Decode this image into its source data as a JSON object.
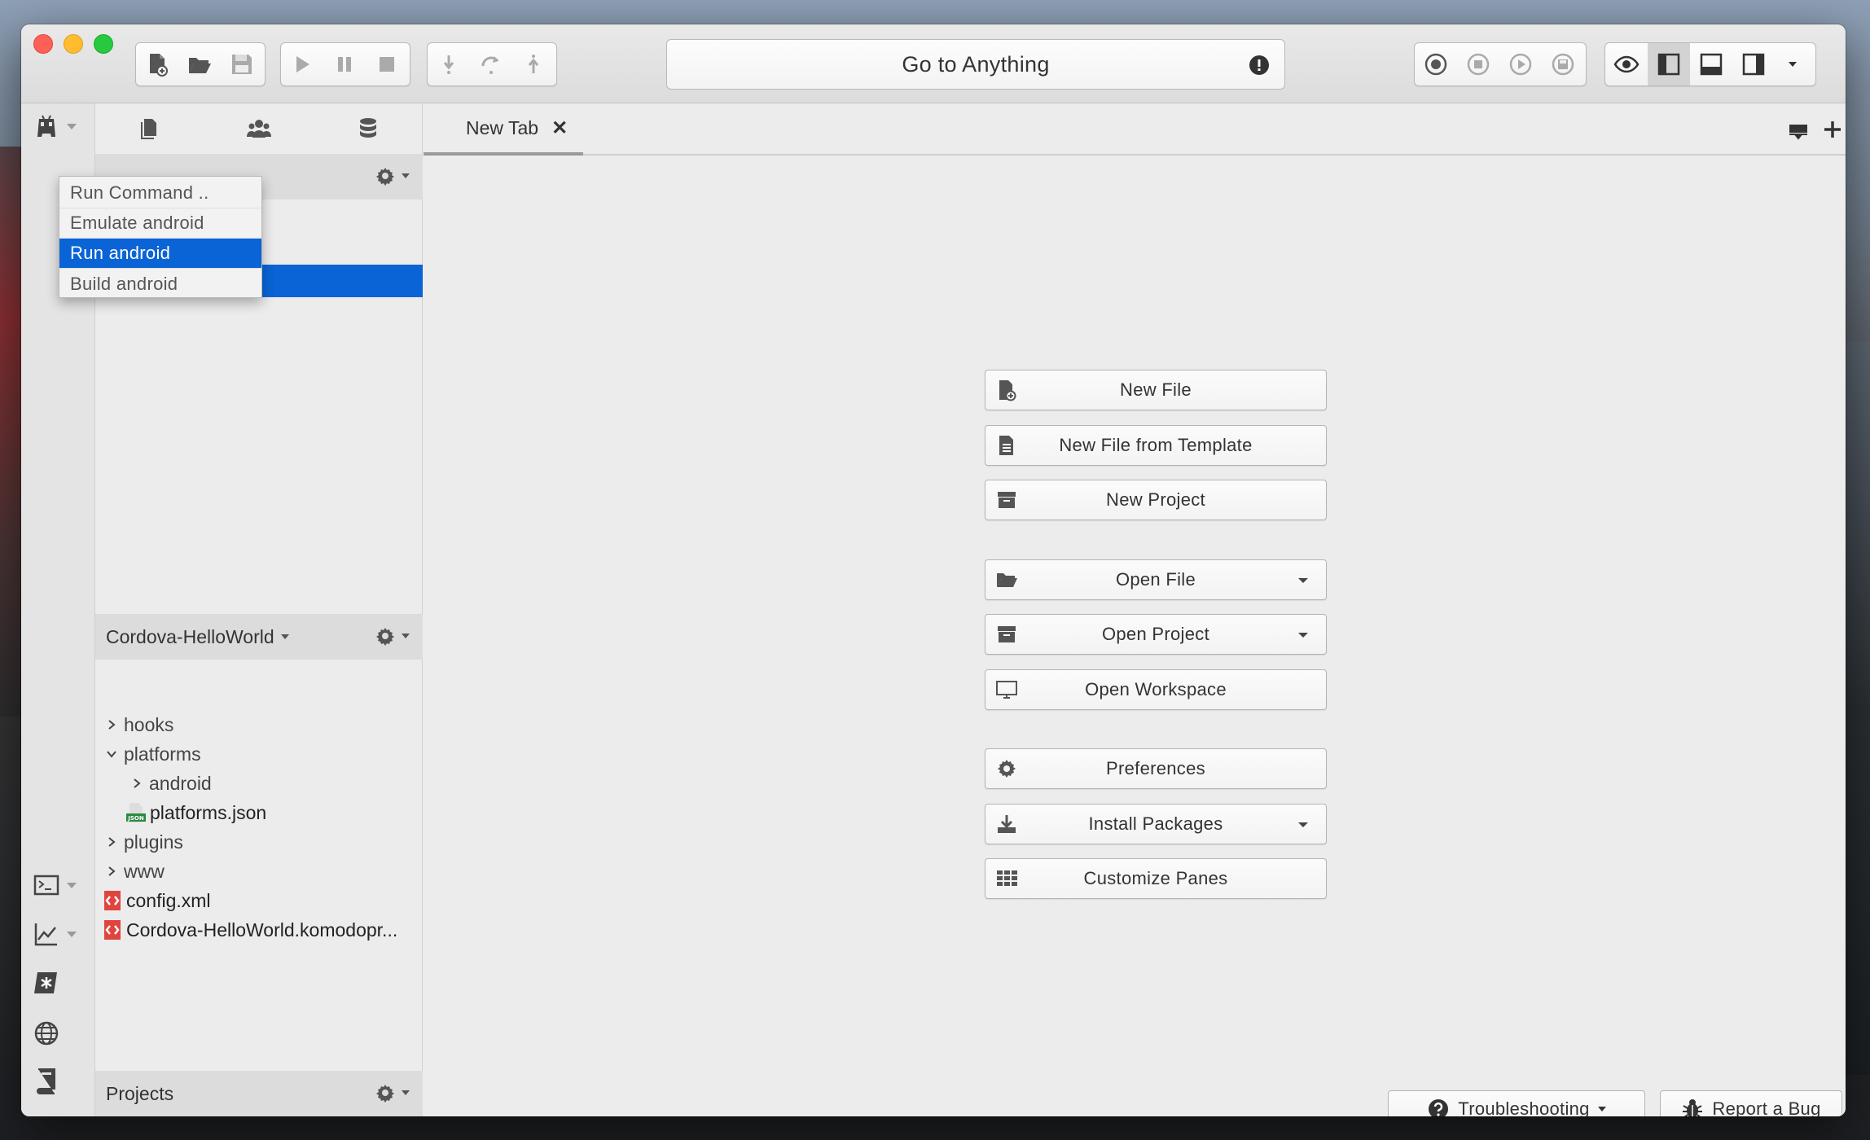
{
  "toolbar": {
    "goto_label": "Go to Anything"
  },
  "dropdown_menu": {
    "items": [
      "Run Command ..",
      "Emulate android",
      "Run android",
      "Build android"
    ],
    "selected": "Run android"
  },
  "sidebar": {
    "project_title": "Cordova-HelloWorld",
    "tree": [
      {
        "label": "hooks",
        "type": "folder",
        "expanded": false,
        "depth": 0
      },
      {
        "label": "platforms",
        "type": "folder",
        "expanded": true,
        "depth": 0
      },
      {
        "label": "android",
        "type": "folder",
        "expanded": false,
        "depth": 1
      },
      {
        "label": "platforms.json",
        "type": "json-file",
        "depth": 1
      },
      {
        "label": "plugins",
        "type": "folder",
        "expanded": false,
        "depth": 0
      },
      {
        "label": "www",
        "type": "folder",
        "expanded": false,
        "depth": 0
      },
      {
        "label": "config.xml",
        "type": "xml-file",
        "depth": 0
      },
      {
        "label": "Cordova-HelloWorld.komodopr...",
        "type": "project-file",
        "depth": 0
      }
    ],
    "bottom_title": "Projects"
  },
  "editor": {
    "tab_label": "New Tab",
    "quick_actions": {
      "new_file": "New File",
      "new_file_template": "New File from Template",
      "new_project": "New Project",
      "open_file": "Open File",
      "open_project": "Open Project",
      "open_workspace": "Open Workspace",
      "preferences": "Preferences",
      "install_packages": "Install Packages",
      "customize_panes": "Customize Panes"
    },
    "footer": {
      "troubleshooting": "Troubleshooting",
      "report_bug": "Report a Bug"
    }
  },
  "colors": {
    "selection": "#0a64d6",
    "close": "#fe5f57",
    "minimize": "#febc2e",
    "maximize": "#28c840"
  }
}
